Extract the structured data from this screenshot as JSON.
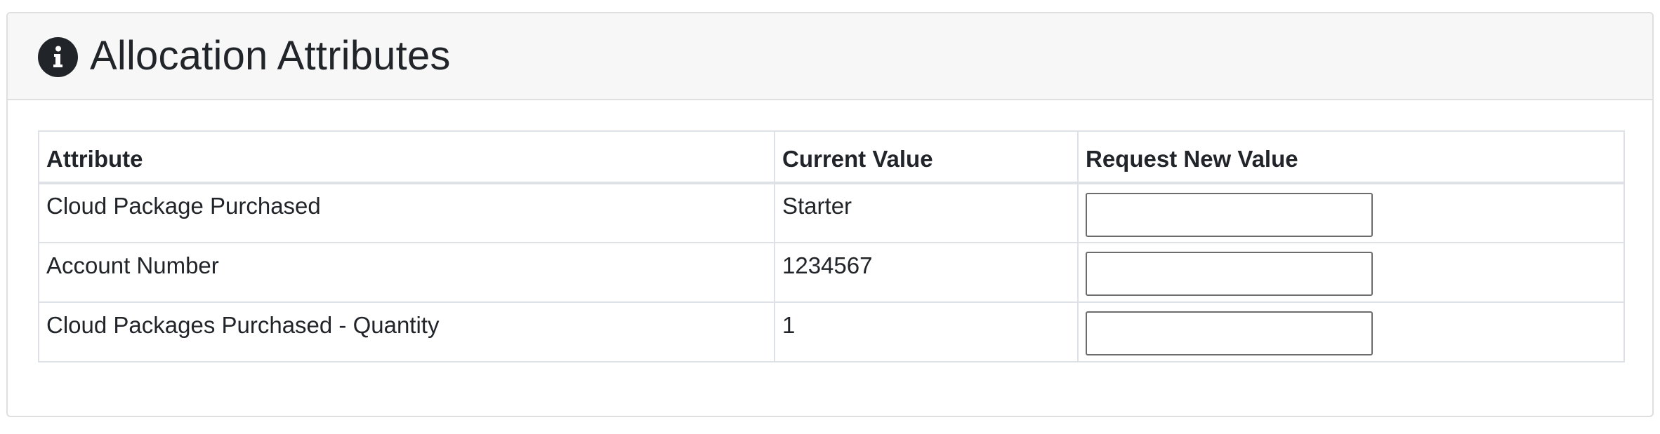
{
  "card": {
    "title": "Allocation Attributes",
    "icon": "info-circle-icon"
  },
  "table": {
    "headers": {
      "attribute": "Attribute",
      "current_value": "Current Value",
      "request_new_value": "Request New Value"
    },
    "rows": [
      {
        "attribute": "Cloud Package Purchased",
        "current_value": "Starter",
        "new_value": ""
      },
      {
        "attribute": "Account Number",
        "current_value": "1234567",
        "new_value": ""
      },
      {
        "attribute": "Cloud Packages Purchased - Quantity",
        "current_value": "1",
        "new_value": ""
      }
    ]
  },
  "colors": {
    "header_background": "#f7f7f7",
    "border": "#dee2e6",
    "text": "#212529",
    "icon_background": "#212529"
  }
}
